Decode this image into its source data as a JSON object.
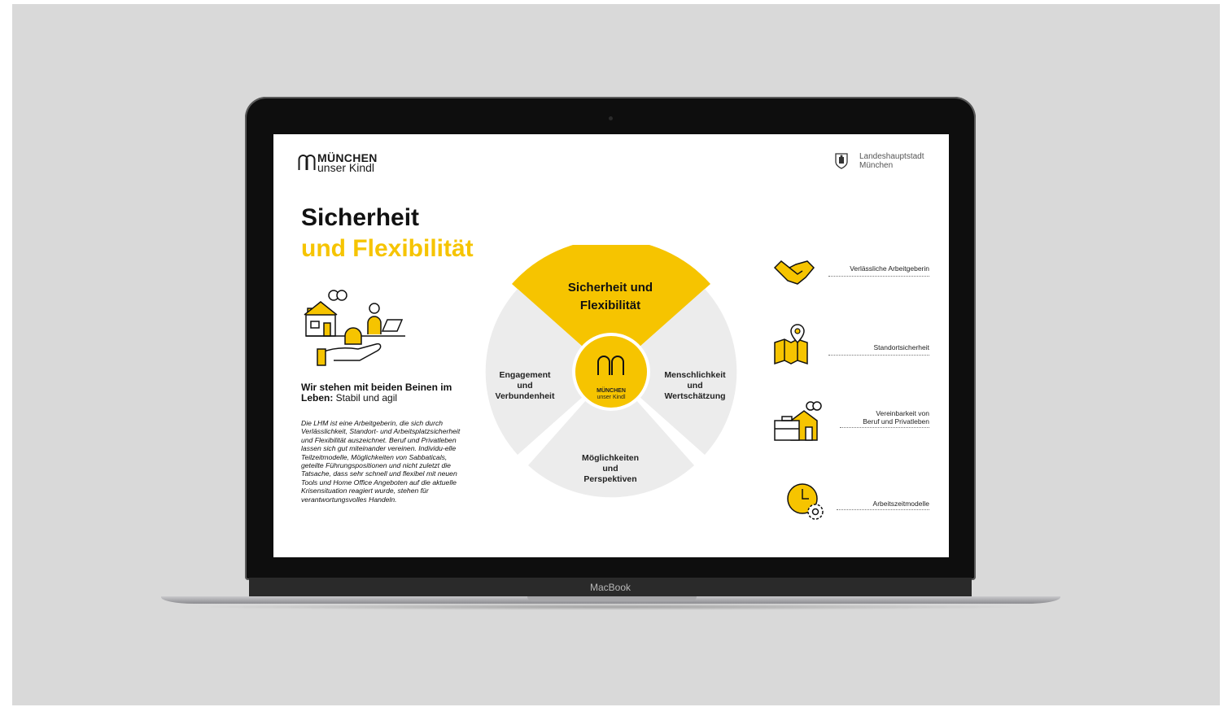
{
  "device": {
    "brand_label": "MacBook"
  },
  "header": {
    "logo_line1": "MÜNCHEN",
    "logo_line2": "unser Kindl",
    "city_line1": "Landeshauptstadt",
    "city_line2": "München"
  },
  "main": {
    "title_line1": "Sicherheit",
    "title_line2": "und Flexibilität",
    "tagline_bold": "Wir stehen mit beiden Beinen im Leben:",
    "tagline_rest": " Stabil und agil",
    "body": "Die LHM ist eine Arbeitgeberin, die sich durch Verlässlichkeit, Standort- und Arbeitsplatzsicherheit und Flexibilität auszeichnet. Beruf und Privatleben lassen sich gut miteinander vereinen. Individu-elle Teilzeitmodelle, Möglichkeiten von Sabbaticals, geteilte Führungspositionen und nicht zuletzt die Tatsache, dass sehr schnell und flexibel mit neuen Tools und Home Office Angeboten auf die aktuelle Krisensituation reagiert wurde, stehen für verantwortungsvolles Handeln."
  },
  "wheel": {
    "top_line1": "Sicherheit und",
    "top_line2": "Flexibilität",
    "left_line1": "Engagement",
    "left_line2": "und",
    "left_line3": "Verbundenheit",
    "right_line1": "Menschlichkeit",
    "right_line2": "und",
    "right_line3": "Wertschätzung",
    "bottom_line1": "Möglichkeiten",
    "bottom_line2": "und",
    "bottom_line3": "Perspektiven",
    "center_line1": "MÜNCHEN",
    "center_line2": "unser Kindl"
  },
  "benefits": [
    {
      "icon": "handshake-icon",
      "label": "Verlässliche Arbeitgeberin"
    },
    {
      "icon": "map-pin-icon",
      "label": "Standortsicherheit"
    },
    {
      "icon": "work-home-icon",
      "label_line1": "Vereinbarkeit von",
      "label_line2": "Beruf und Privatleben"
    },
    {
      "icon": "clock-gear-icon",
      "label": "Arbeitszeitmodelle"
    }
  ],
  "colors": {
    "accent": "#f6c400",
    "wheel_grey": "#ececec",
    "backdrop": "#d9d9d9"
  }
}
